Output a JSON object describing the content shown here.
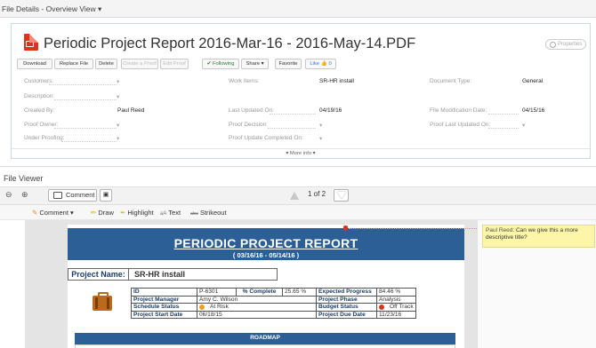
{
  "topbar": {
    "title": "File Details - Overview View ▾"
  },
  "file": {
    "title": "Periodic Project Report 2016-Mar-16 - 2016-May-14.PDF",
    "properties_label": "Properties"
  },
  "toolbar": {
    "download": "Download",
    "replace": "Replace File",
    "delete": "Delete",
    "create_proof": "Create a Proof",
    "edit_proof": "Edit Proof",
    "following": "✔ Following",
    "share": "Share ▾",
    "favorite": "Favorite",
    "like": "Like",
    "like_count": "0"
  },
  "fields": {
    "customers": "Customers:",
    "description": "Description:",
    "created_by": "Created By:",
    "created_by_value": "Paul Reed",
    "proof_owner": "Proof Owner:",
    "under_proofing": "Under Proofing:",
    "work_items": "Work Items:",
    "work_items_value": "SR-HR install",
    "last_updated": "Last Updated On:",
    "last_updated_value": "04/19/16",
    "proof_decision": "Proof Decision:",
    "proof_update": "Proof Update Completed On:",
    "doc_type": "Document Type:",
    "doc_type_value": "General",
    "file_mod": "File Modification Date:",
    "file_mod_value": "04/15/16",
    "proof_last": "Proof Last Updated On:",
    "dropdown": "▾",
    "more_info": "▾ More info ▾"
  },
  "viewer": {
    "title": "File Viewer",
    "zoom_out": "⊖",
    "zoom_in": "⊕",
    "comment_btn": "Comment",
    "page_text": "1 of 2"
  },
  "annotate": {
    "comment": "Comment",
    "comment_arrow": "▾",
    "draw": "Draw",
    "highlight": "Highlight",
    "text": "Text",
    "text_icon": "aA",
    "strikeout": "Strikeout",
    "strike_icon": "abc"
  },
  "report": {
    "title": "PERIODIC PROJECT REPORT",
    "dates": "( 03/16/16 - 05/14/16 )",
    "project_name_label": "Project Name:",
    "project_name": "SR-HR install",
    "rows": [
      [
        "ID",
        "P-6301",
        "% Complete",
        "25.65",
        "%",
        "Expected Progress",
        "84.46",
        "%"
      ],
      [
        "Project Manager",
        "Amy C. Wilson",
        "Project Phase",
        "Analysis"
      ],
      [
        "Schedule Status",
        "At Risk",
        "Budget Status",
        "Off Track"
      ],
      [
        "Project Start Date",
        "06/18/15",
        "Project Due Date",
        "11/23/16"
      ]
    ],
    "roadmap": "ROADMAP",
    "status_colors": {
      "at_risk": "#f0a020",
      "off_track": "#d9351c"
    }
  },
  "comment": {
    "author": "Paul Reed:",
    "text": "Can we give this a more descriptive title?"
  }
}
